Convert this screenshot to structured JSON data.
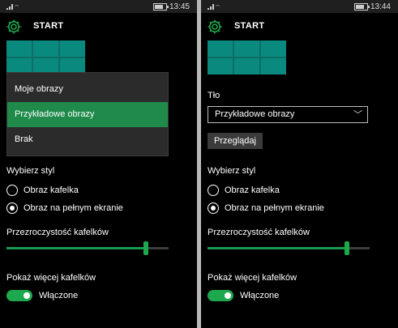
{
  "status_left": {
    "time": "13:45"
  },
  "status_right": {
    "time": "13:44"
  },
  "app": {
    "title": "START"
  },
  "dropdown": {
    "items": [
      "Moje obrazy",
      "Przykładowe obrazy",
      "Brak"
    ],
    "selected_index": 1
  },
  "background": {
    "label": "Tło",
    "selected": "Przykładowe obrazy",
    "browse_label": "Przeglądaj"
  },
  "style": {
    "label": "Wybierz styl",
    "options": [
      "Obraz kafelka",
      "Obraz na pełnym ekranie"
    ],
    "selected_index": 1
  },
  "transparency": {
    "label": "Przezroczystość kafelków",
    "value_fraction": 0.86
  },
  "more_tiles": {
    "label": "Pokaż więcej kafelków",
    "state": "Włączone",
    "on": true
  },
  "colors": {
    "accent": "#1ea84e",
    "background": "#000000",
    "tile": "#0e6c64"
  },
  "icons": {
    "settings": "gear-icon",
    "chevron": "chevron-down-icon"
  }
}
